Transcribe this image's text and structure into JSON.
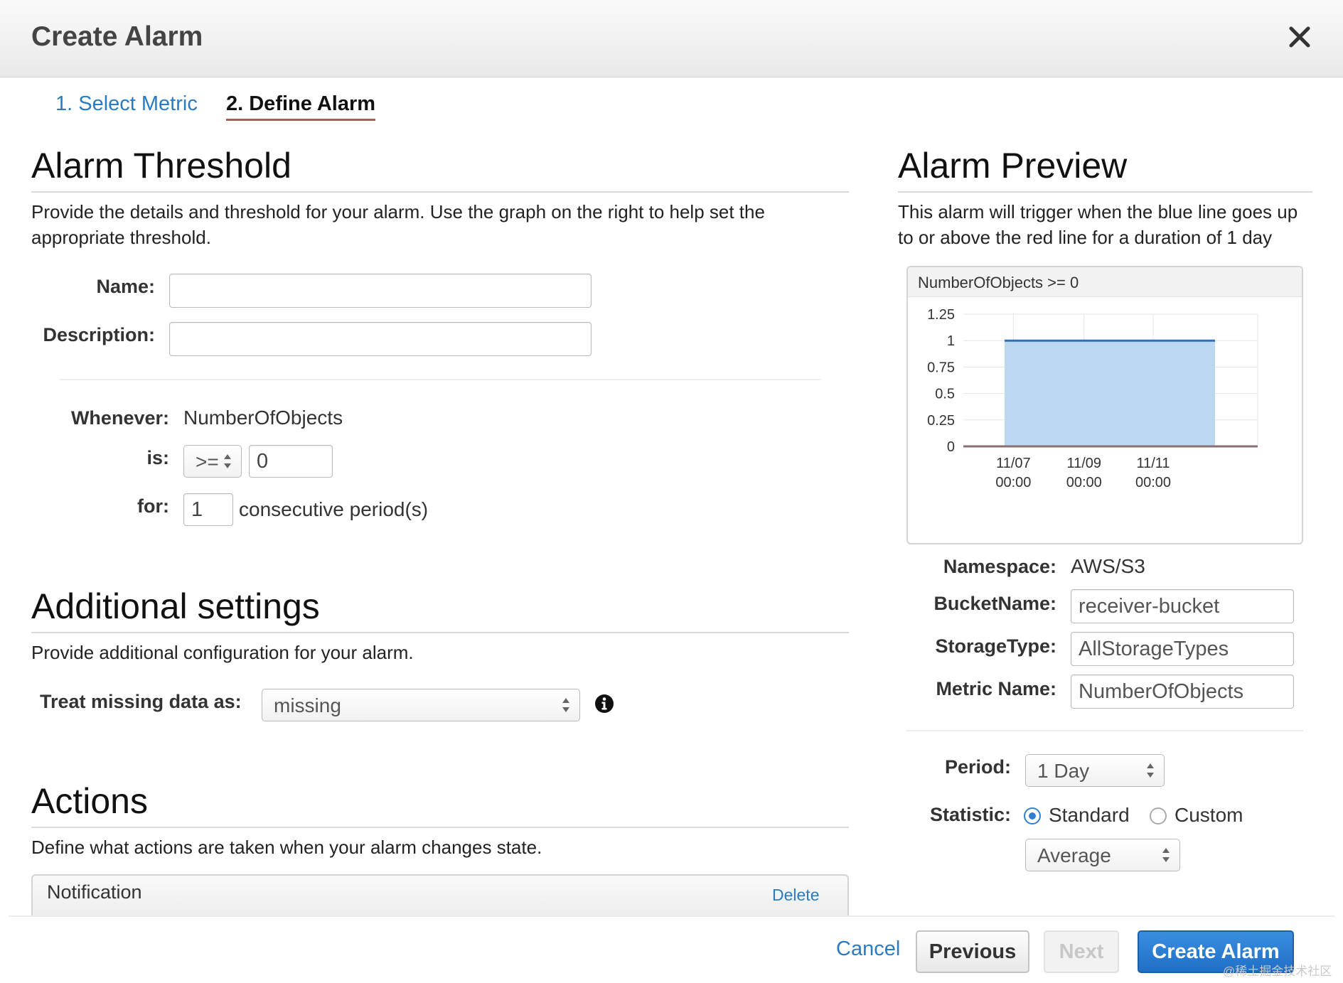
{
  "header": {
    "title": "Create Alarm"
  },
  "tabs": [
    {
      "label": "1. Select Metric"
    },
    {
      "label": "2. Define Alarm"
    }
  ],
  "threshold": {
    "title": "Alarm Threshold",
    "description_line1": "Provide the details and threshold for your alarm. Use the graph on the right to help set the",
    "description_line2": "appropriate threshold.",
    "name_label": "Name:",
    "name_value": "",
    "description_label": "Description:",
    "description_value": "",
    "whenever_label": "Whenever:",
    "whenever_value": "NumberOfObjects",
    "is_label": "is:",
    "operator": ">=",
    "threshold_value": "0",
    "for_label": "for:",
    "periods_value": "1",
    "periods_suffix": "consecutive period(s)"
  },
  "additional": {
    "title": "Additional settings",
    "description": "Provide additional configuration for your alarm.",
    "missing_label": "Treat missing data as:",
    "missing_value": "missing"
  },
  "actions": {
    "title": "Actions",
    "description": "Define what actions are taken when your alarm changes state.",
    "notification_label": "Notification",
    "delete_label": "Delete"
  },
  "preview": {
    "title": "Alarm Preview",
    "description_line1": "This alarm will trigger when the blue line goes up",
    "description_line2": "to or above the red line for a duration of 1 day",
    "chart_header": "NumberOfObjects >= 0",
    "namespace_label": "Namespace:",
    "namespace_value": "AWS/S3",
    "bucket_label": "BucketName:",
    "bucket_value": "receiver-bucket",
    "storage_label": "StorageType:",
    "storage_value": "AllStorageTypes",
    "metric_label": "Metric Name:",
    "metric_value": "NumberOfObjects",
    "period_label": "Period:",
    "period_value": "1 Day",
    "statistic_label": "Statistic:",
    "statistic_standard": "Standard",
    "statistic_custom": "Custom",
    "statistic_selected": "Standard",
    "statistic_value": "Average"
  },
  "footer": {
    "cancel_label": "Cancel",
    "previous_label": "Previous",
    "next_label": "Next",
    "create_label": "Create Alarm"
  },
  "watermark": "@稀土掘金技术社区",
  "colors": {
    "link": "#2b7bc0",
    "series_fill": "#bcd7f0",
    "series_line": "#2f6fc0",
    "threshold_line": "#8a6f6f",
    "primary_button": "#1f6fc6"
  },
  "chart_data": {
    "type": "area",
    "title": "NumberOfObjects >= 0",
    "x_tick_labels": [
      [
        "11/07",
        "00:00"
      ],
      [
        "11/09",
        "00:00"
      ],
      [
        "11/11",
        "00:00"
      ]
    ],
    "y_tick_labels": [
      "1.25",
      "1",
      "0.75",
      "0.5",
      "0.25",
      "0"
    ],
    "ylim": [
      0,
      1.25
    ],
    "series": [
      {
        "values": [
          1,
          1,
          1,
          1,
          1,
          1
        ]
      }
    ],
    "threshold": 0,
    "grid": true
  }
}
